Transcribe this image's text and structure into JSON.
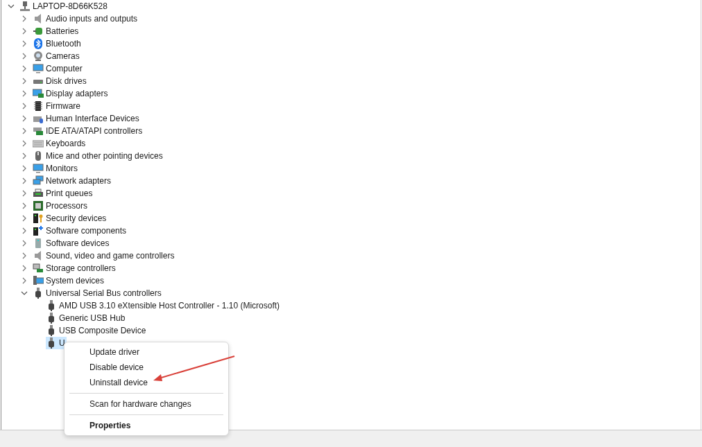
{
  "tree": {
    "label": "LAPTOP-8D66K528",
    "expanded": true,
    "selected": false,
    "children": [
      {
        "label": "Audio inputs and outputs",
        "expanded": false,
        "selected": false
      },
      {
        "label": "Batteries",
        "expanded": false,
        "selected": false
      },
      {
        "label": "Bluetooth",
        "expanded": false,
        "selected": false
      },
      {
        "label": "Cameras",
        "expanded": false,
        "selected": false
      },
      {
        "label": "Computer",
        "expanded": false,
        "selected": false
      },
      {
        "label": "Disk drives",
        "expanded": false,
        "selected": false
      },
      {
        "label": "Display adapters",
        "expanded": false,
        "selected": false
      },
      {
        "label": "Firmware",
        "expanded": false,
        "selected": false
      },
      {
        "label": "Human Interface Devices",
        "expanded": false,
        "selected": false
      },
      {
        "label": "IDE ATA/ATAPI controllers",
        "expanded": false,
        "selected": false
      },
      {
        "label": "Keyboards",
        "expanded": false,
        "selected": false
      },
      {
        "label": "Mice and other pointing devices",
        "expanded": false,
        "selected": false
      },
      {
        "label": "Monitors",
        "expanded": false,
        "selected": false
      },
      {
        "label": "Network adapters",
        "expanded": false,
        "selected": false
      },
      {
        "label": "Print queues",
        "expanded": false,
        "selected": false
      },
      {
        "label": "Processors",
        "expanded": false,
        "selected": false
      },
      {
        "label": "Security devices",
        "expanded": false,
        "selected": false
      },
      {
        "label": "Software components",
        "expanded": false,
        "selected": false
      },
      {
        "label": "Software devices",
        "expanded": false,
        "selected": false
      },
      {
        "label": "Sound, video and game controllers",
        "expanded": false,
        "selected": false
      },
      {
        "label": "Storage controllers",
        "expanded": false,
        "selected": false
      },
      {
        "label": "System devices",
        "expanded": false,
        "selected": false
      },
      {
        "label": "Universal Serial Bus controllers",
        "expanded": true,
        "selected": false,
        "children": [
          {
            "label": "AMD USB 3.10 eXtensible Host Controller - 1.10 (Microsoft)",
            "selected": false
          },
          {
            "label": "Generic USB Hub",
            "selected": false
          },
          {
            "label": "USB Composite Device",
            "selected": false
          },
          {
            "label": "U",
            "selected": true
          }
        ]
      }
    ]
  },
  "context_menu": [
    {
      "kind": "item",
      "label": "Update driver"
    },
    {
      "kind": "item",
      "label": "Disable device"
    },
    {
      "kind": "item",
      "label": "Uninstall device"
    },
    {
      "kind": "separator"
    },
    {
      "kind": "item",
      "label": "Scan for hardware changes"
    },
    {
      "kind": "separator"
    },
    {
      "kind": "default",
      "label": "Properties"
    }
  ]
}
